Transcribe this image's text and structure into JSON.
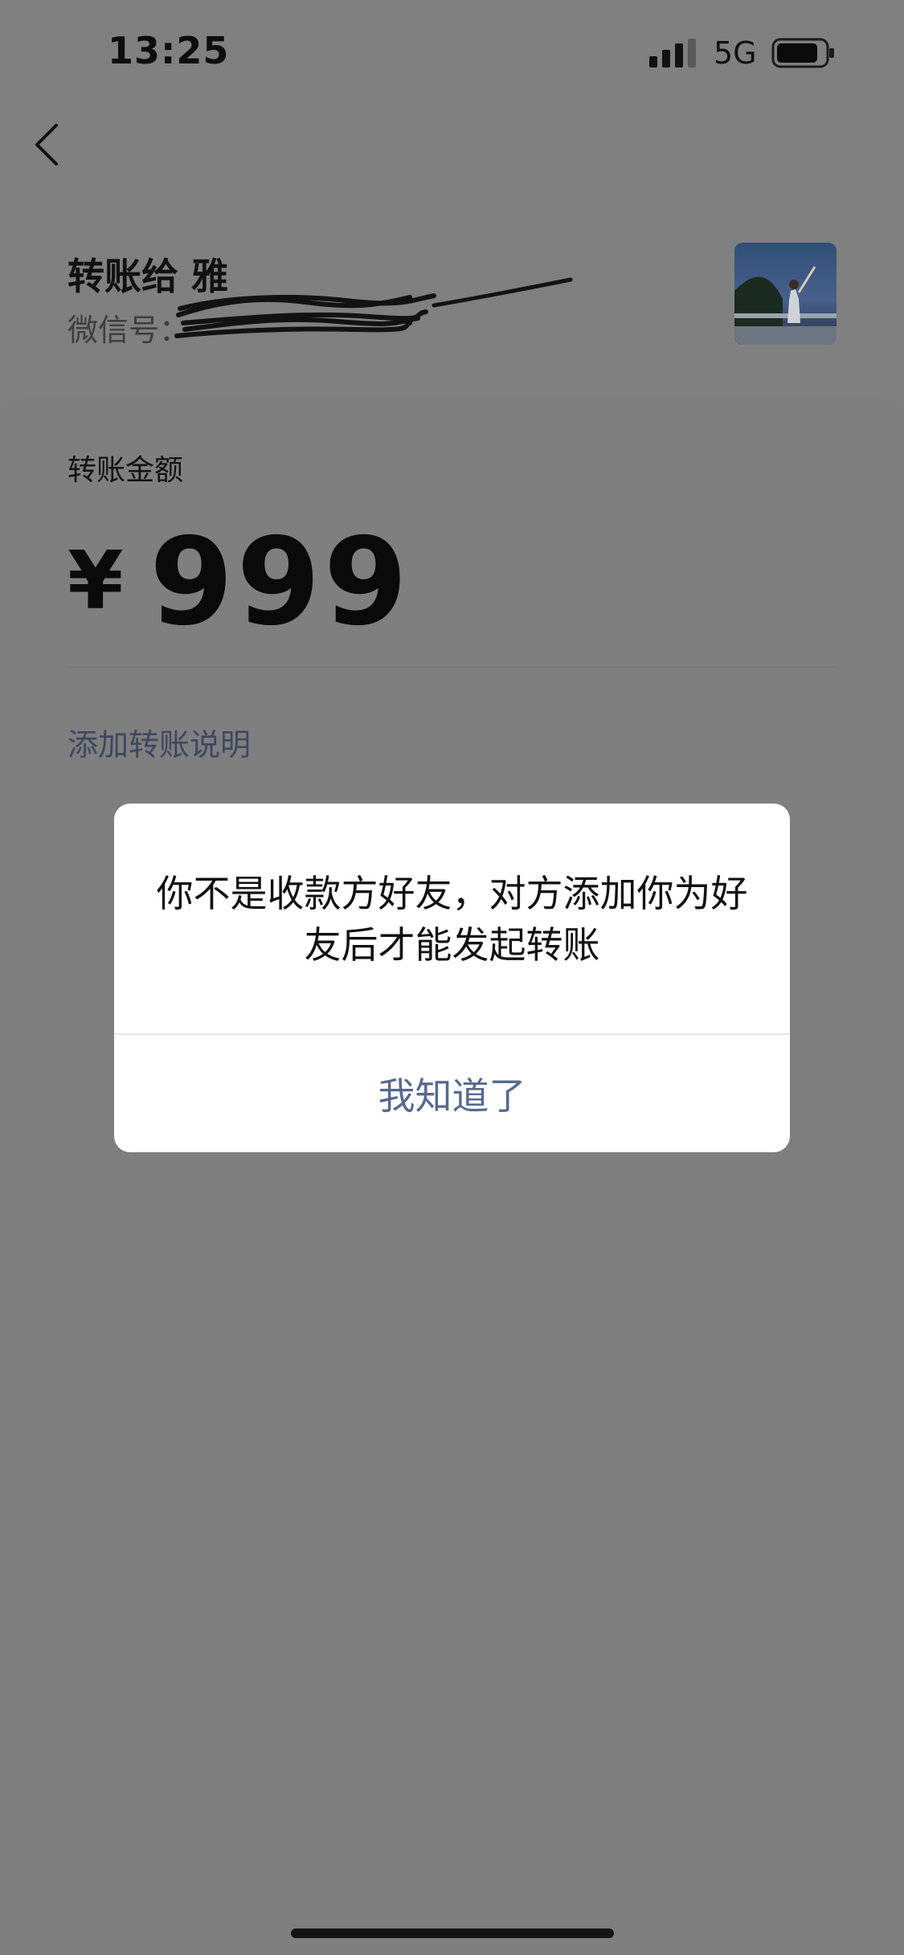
{
  "status_bar": {
    "time": "13:25",
    "network": "5G",
    "icons": [
      "signal-icon",
      "battery-icon"
    ]
  },
  "header": {
    "back_icon": "chevron-left-icon",
    "transfer_to": "转账给 雅",
    "wechat_label": "微信号："
  },
  "card": {
    "amount_label": "转账金额",
    "currency": "¥",
    "amount": "999",
    "add_note": "添加转账说明"
  },
  "dialog": {
    "message": "你不是收款方好友，对方添加你为好友后才能发起转账",
    "button": "我知道了"
  },
  "colors": {
    "overlay_background": "#808080",
    "dialog_background": "#ffffff",
    "dialog_button_text": "#56698e",
    "link_text": "#3e4760"
  }
}
